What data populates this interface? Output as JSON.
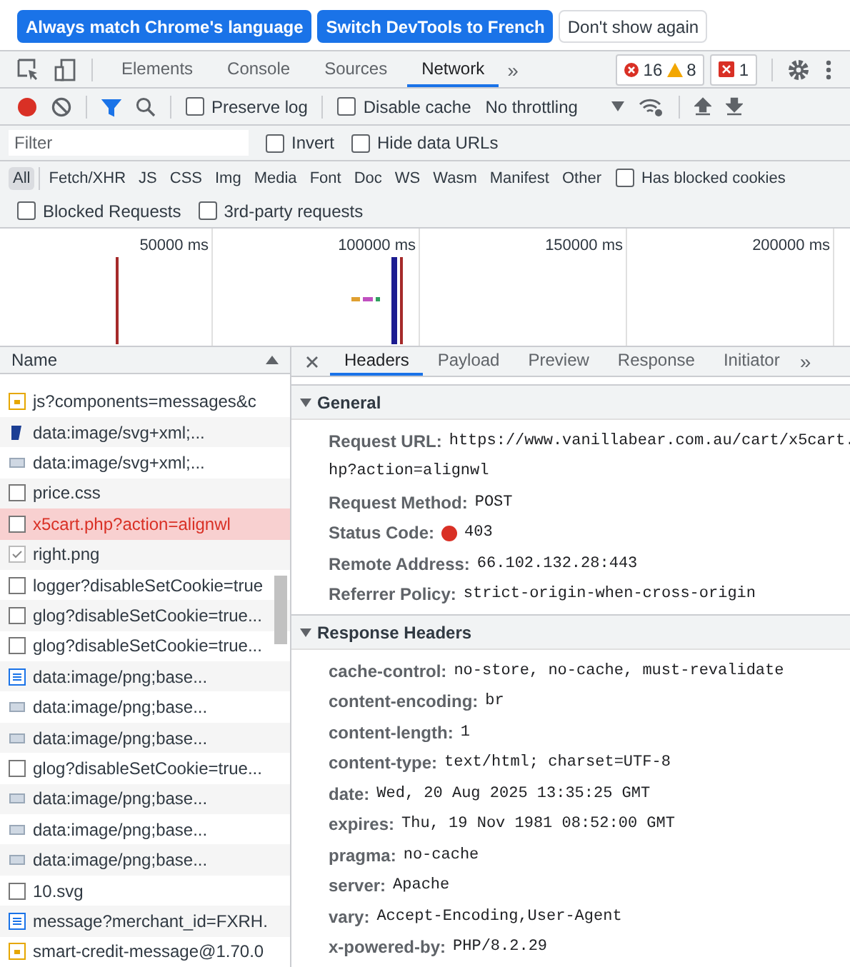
{
  "banner": {
    "buttons": [
      {
        "label": "Always match Chrome's language",
        "kind": "primary"
      },
      {
        "label": "Switch DevTools to French",
        "kind": "primary"
      },
      {
        "label": "Don't show again",
        "kind": "plain"
      }
    ]
  },
  "main_tabs": [
    {
      "label": "Elements",
      "selected": false
    },
    {
      "label": "Console",
      "selected": false
    },
    {
      "label": "Sources",
      "selected": false
    },
    {
      "label": "Network",
      "selected": true
    }
  ],
  "more_tabs": "»",
  "counters": {
    "errors": "16",
    "warnings": "8",
    "issues": "1"
  },
  "network_toolbar": {
    "recording": true,
    "filter_active": true,
    "preserve_log": {
      "label": "Preserve log",
      "checked": false
    },
    "disable_cache": {
      "label": "Disable cache",
      "checked": false
    },
    "throttling": "No throttling"
  },
  "filter": {
    "placeholder": "Filter",
    "options": [
      {
        "label": "Invert",
        "checked": false
      },
      {
        "label": "Hide data URLs",
        "checked": false
      }
    ]
  },
  "type_filters": [
    {
      "label": "All",
      "selected": true
    },
    {
      "label": "Fetch/XHR",
      "selected": false
    },
    {
      "label": "JS",
      "selected": false
    },
    {
      "label": "CSS",
      "selected": false
    },
    {
      "label": "Img",
      "selected": false
    },
    {
      "label": "Media",
      "selected": false
    },
    {
      "label": "Font",
      "selected": false
    },
    {
      "label": "Doc",
      "selected": false
    },
    {
      "label": "WS",
      "selected": false
    },
    {
      "label": "Wasm",
      "selected": false
    },
    {
      "label": "Manifest",
      "selected": false
    },
    {
      "label": "Other",
      "selected": false
    }
  ],
  "blocked_cookies": {
    "label": "Has blocked cookies",
    "checked": false
  },
  "extra_filters": [
    {
      "label": "Blocked Requests",
      "checked": false
    },
    {
      "label": "3rd-party requests",
      "checked": false
    }
  ],
  "timeline": {
    "ticks": [
      "50000 ms",
      "100000 ms",
      "150000 ms",
      "200000 ms"
    ]
  },
  "request_list": {
    "column": "Name",
    "rows": [
      {
        "name": "js?components=messages&c",
        "kind": "script",
        "selected": false,
        "error": false
      },
      {
        "name": "data:image/svg+xml;...",
        "kind": "logo",
        "selected": false,
        "error": false
      },
      {
        "name": "data:image/svg+xml;...",
        "kind": "image",
        "selected": false,
        "error": false
      },
      {
        "name": "price.css",
        "kind": "file",
        "selected": false,
        "error": false
      },
      {
        "name": "x5cart.php?action=alignwl",
        "kind": "file",
        "selected": true,
        "error": true
      },
      {
        "name": "right.png",
        "kind": "check",
        "selected": false,
        "error": false
      },
      {
        "name": "logger?disableSetCookie=true",
        "kind": "file",
        "selected": false,
        "error": false
      },
      {
        "name": "glog?disableSetCookie=true...",
        "kind": "file",
        "selected": false,
        "error": false
      },
      {
        "name": "glog?disableSetCookie=true...",
        "kind": "file",
        "selected": false,
        "error": false
      },
      {
        "name": "data:image/png;base...",
        "kind": "doc",
        "selected": false,
        "error": false
      },
      {
        "name": "data:image/png;base...",
        "kind": "image",
        "selected": false,
        "error": false
      },
      {
        "name": "data:image/png;base...",
        "kind": "image",
        "selected": false,
        "error": false
      },
      {
        "name": "glog?disableSetCookie=true...",
        "kind": "file",
        "selected": false,
        "error": false
      },
      {
        "name": "data:image/png;base...",
        "kind": "image",
        "selected": false,
        "error": false
      },
      {
        "name": "data:image/png;base...",
        "kind": "image",
        "selected": false,
        "error": false
      },
      {
        "name": "data:image/png;base...",
        "kind": "image",
        "selected": false,
        "error": false
      },
      {
        "name": "10.svg",
        "kind": "file",
        "selected": false,
        "error": false
      },
      {
        "name": "message?merchant_id=FXRH.",
        "kind": "doc",
        "selected": false,
        "error": false
      },
      {
        "name": "smart-credit-message@1.70.0",
        "kind": "script",
        "selected": false,
        "error": false
      }
    ]
  },
  "detail_tabs": [
    {
      "label": "Headers",
      "selected": true
    },
    {
      "label": "Payload",
      "selected": false
    },
    {
      "label": "Preview",
      "selected": false
    },
    {
      "label": "Response",
      "selected": false
    },
    {
      "label": "Initiator",
      "selected": false
    }
  ],
  "sections": [
    {
      "title": "General",
      "expanded": true,
      "rows": [
        {
          "name": "Request URL:",
          "value": "https://www.vanillabear.com.au/cart/x5cart.",
          "continuation": "hp?action=alignwl"
        },
        {
          "name": "Request Method:",
          "value": "POST"
        },
        {
          "name": "Status Code:",
          "value": "403",
          "color": "#d93025"
        },
        {
          "name": "Remote Address:",
          "value": "66.102.132.28:443"
        },
        {
          "name": "Referrer Policy:",
          "value": "strict-origin-when-cross-origin"
        }
      ]
    },
    {
      "title": "Response Headers",
      "expanded": true,
      "rows": [
        {
          "name": "cache-control:",
          "value": "no-store, no-cache, must-revalidate"
        },
        {
          "name": "content-encoding:",
          "value": "br"
        },
        {
          "name": "content-length:",
          "value": "1"
        },
        {
          "name": "content-type:",
          "value": "text/html; charset=UTF-8"
        },
        {
          "name": "date:",
          "value": "Wed, 20 Aug 2025 13:35:25 GMT"
        },
        {
          "name": "expires:",
          "value": "Thu, 19 Nov 1981 08:52:00 GMT"
        },
        {
          "name": "pragma:",
          "value": "no-cache"
        },
        {
          "name": "server:",
          "value": "Apache"
        },
        {
          "name": "vary:",
          "value": "Accept-Encoding,User-Agent"
        },
        {
          "name": "x-powered-by:",
          "value": "PHP/8.2.29"
        }
      ]
    }
  ]
}
